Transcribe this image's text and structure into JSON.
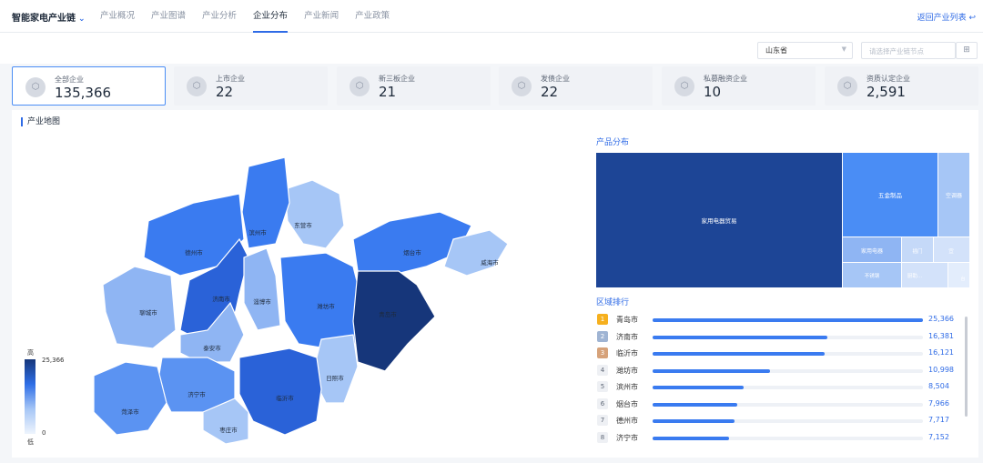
{
  "header": {
    "chain_name": "智能家电产业链",
    "tabs": [
      "产业概况",
      "产业图谱",
      "产业分析",
      "企业分布",
      "产业新闻",
      "产业政策"
    ],
    "active_tab": "企业分布",
    "back_link": "返回产业列表"
  },
  "filters": {
    "province": "山东省",
    "search_placeholder": "请选择产业链节点"
  },
  "stats": [
    {
      "label": "全部企业",
      "value": "135,366",
      "icon": "building-icon"
    },
    {
      "label": "上市企业",
      "value": "22",
      "icon": "listed-icon"
    },
    {
      "label": "新三板企业",
      "value": "21",
      "icon": "board-icon"
    },
    {
      "label": "发债企业",
      "value": "22",
      "icon": "bond-icon"
    },
    {
      "label": "私募融资企业",
      "value": "10",
      "icon": "fund-icon"
    },
    {
      "label": "资质认定企业",
      "value": "2,591",
      "icon": "cert-icon"
    }
  ],
  "map": {
    "title": "产业地图",
    "legend_high": "高",
    "legend_low": "低",
    "legend_max": "25,366",
    "legend_min": "0",
    "cities": [
      {
        "name": "东营市",
        "color": "#a6c6f6"
      },
      {
        "name": "滨州市",
        "color": "#3a7bf0"
      },
      {
        "name": "德州市",
        "color": "#3a7bf0"
      },
      {
        "name": "聊城市",
        "color": "#8fb5f3"
      },
      {
        "name": "济南市",
        "color": "#2a62d8"
      },
      {
        "name": "淄博市",
        "color": "#8fb5f3"
      },
      {
        "name": "潍坊市",
        "color": "#3a7bf0"
      },
      {
        "name": "烟台市",
        "color": "#3a7bf0"
      },
      {
        "name": "威海市",
        "color": "#a6c6f6"
      },
      {
        "name": "青岛市",
        "color": "#16367a"
      },
      {
        "name": "泰安市",
        "color": "#8fb5f3"
      },
      {
        "name": "日照市",
        "color": "#a6c6f6"
      },
      {
        "name": "临沂市",
        "color": "#2a62d8"
      },
      {
        "name": "济宁市",
        "color": "#5b93f2"
      },
      {
        "name": "菏泽市",
        "color": "#5b93f2"
      },
      {
        "name": "枣庄市",
        "color": "#a6c6f6"
      }
    ]
  },
  "product": {
    "title": "产品分布",
    "blocks": [
      "家用电器贸易",
      "五金制品",
      "空调器",
      "家用电器",
      "插门",
      "宜",
      "不锈钢",
      "厨助...",
      "台"
    ]
  },
  "ranking": {
    "title": "区域排行",
    "rows": [
      {
        "rank": "1",
        "name": "青岛市",
        "value": "25,366",
        "num": 25366
      },
      {
        "rank": "2",
        "name": "济南市",
        "value": "16,381",
        "num": 16381
      },
      {
        "rank": "3",
        "name": "临沂市",
        "value": "16,121",
        "num": 16121
      },
      {
        "rank": "4",
        "name": "潍坊市",
        "value": "10,998",
        "num": 10998
      },
      {
        "rank": "5",
        "name": "滨州市",
        "value": "8,504",
        "num": 8504
      },
      {
        "rank": "6",
        "name": "烟台市",
        "value": "7,966",
        "num": 7966
      },
      {
        "rank": "7",
        "name": "德州市",
        "value": "7,717",
        "num": 7717
      },
      {
        "rank": "8",
        "name": "济宁市",
        "value": "7,152",
        "num": 7152
      }
    ]
  }
}
